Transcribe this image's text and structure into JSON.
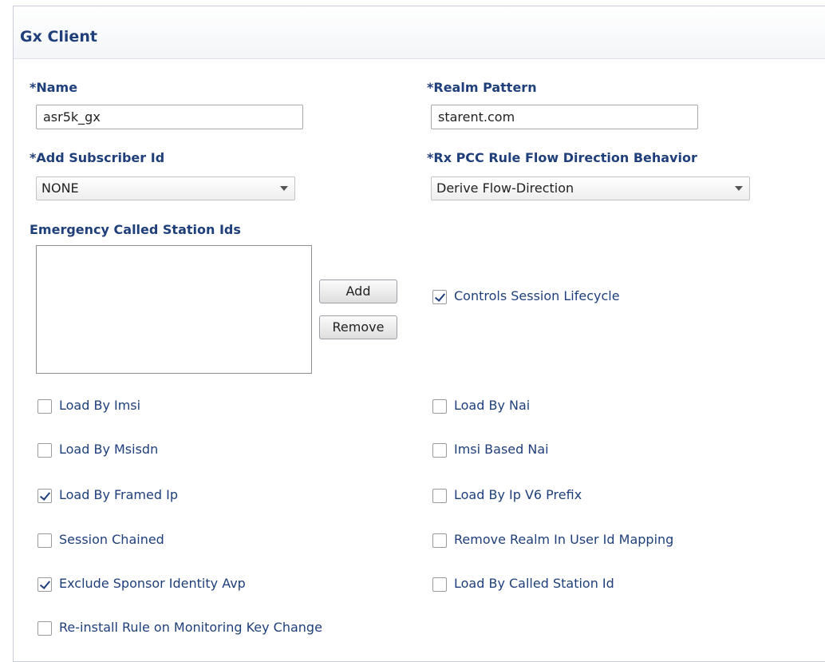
{
  "panel": {
    "title": "Gx Client"
  },
  "fields": {
    "name": {
      "label": "*Name",
      "value": "asr5k_gx"
    },
    "realm_pattern": {
      "label": "*Realm Pattern",
      "value": "starent.com"
    },
    "add_subscriber_id": {
      "label": "*Add Subscriber Id",
      "value": "NONE"
    },
    "rx_pcc_rule": {
      "label": "*Rx PCC Rule Flow Direction Behavior",
      "value": "Derive Flow-Direction"
    },
    "emergency": {
      "label": "Emergency Called Station Ids",
      "add_label": "Add",
      "remove_label": "Remove"
    }
  },
  "checkboxes": {
    "controls_session_lifecycle": {
      "label": "Controls Session Lifecycle",
      "checked": true
    },
    "load_by_imsi": {
      "label": "Load By Imsi",
      "checked": false
    },
    "load_by_nai": {
      "label": "Load By Nai",
      "checked": false
    },
    "load_by_msisdn": {
      "label": "Load By Msisdn",
      "checked": false
    },
    "imsi_based_nai": {
      "label": "Imsi Based Nai",
      "checked": false
    },
    "load_by_framed_ip": {
      "label": "Load By Framed Ip",
      "checked": true
    },
    "load_by_ip_v6_prefix": {
      "label": "Load By Ip V6 Prefix",
      "checked": false
    },
    "session_chained": {
      "label": "Session Chained",
      "checked": false
    },
    "remove_realm": {
      "label": "Remove Realm In User Id Mapping",
      "checked": false
    },
    "exclude_sponsor": {
      "label": "Exclude Sponsor Identity Avp",
      "checked": true
    },
    "load_by_called_station_id": {
      "label": "Load By Called Station Id",
      "checked": false
    },
    "reinstall_rule": {
      "label": "Re-install Rule on Monitoring Key Change",
      "checked": false
    }
  }
}
